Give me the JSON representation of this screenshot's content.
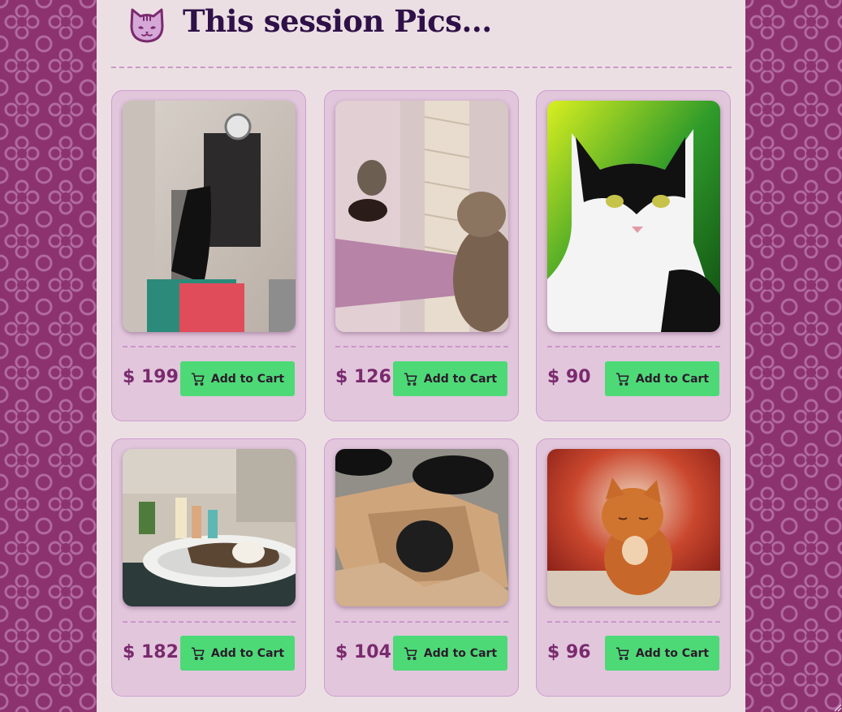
{
  "page": {
    "title": "This session Pics...",
    "logo_icon": "cat-face-icon",
    "colors": {
      "background": "#8c336f",
      "panel": "#ecdfe3",
      "card": "#e2c6dc",
      "title": "#2e1148",
      "price": "#7a2a6e",
      "button": "#4ed977"
    }
  },
  "products": [
    {
      "price": "$ 199",
      "button_label": "Add to Cart",
      "button_icon": "shopping-cart-icon",
      "image": "black cat climbing shelf"
    },
    {
      "price": "$ 126",
      "button_label": "Add to Cart",
      "button_icon": "shopping-cart-icon",
      "image": "tabby kitten with toy mouse on scratching post"
    },
    {
      "price": "$ 90",
      "button_label": "Add to Cart",
      "button_icon": "shopping-cart-icon",
      "image": "black and white cat on green background"
    },
    {
      "price": "$ 182",
      "button_label": "Add to Cart",
      "button_icon": "shopping-cart-icon",
      "image": "cat lying in bathroom sink"
    },
    {
      "price": "$ 104",
      "button_label": "Add to Cart",
      "button_icon": "shopping-cart-icon",
      "image": "black kittens in paper bag"
    },
    {
      "price": "$ 96",
      "button_label": "Add to Cart",
      "button_icon": "shopping-cart-icon",
      "image": "orange kitten sleeping"
    }
  ]
}
